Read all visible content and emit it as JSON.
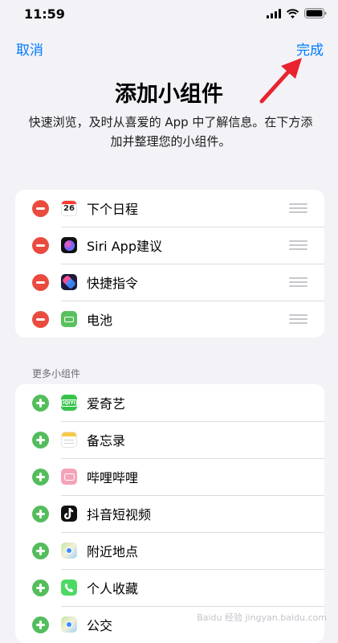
{
  "status": {
    "time": "11:59"
  },
  "nav": {
    "cancel": "取消",
    "done": "完成"
  },
  "title": "添加小组件",
  "subtitle": "快速浏览，及时从喜爱的 App 中了解信息。在下方添加并整理您的小组件。",
  "active_widgets": [
    {
      "label": "下个日程",
      "icon": "calendar-icon",
      "icon_text": "26"
    },
    {
      "label": "Siri App建议",
      "icon": "siri-icon"
    },
    {
      "label": "快捷指令",
      "icon": "shortcuts-icon"
    },
    {
      "label": "电池",
      "icon": "battery-widget-icon"
    }
  ],
  "more_header": "更多小组件",
  "more_widgets": [
    {
      "label": "爱奇艺",
      "icon": "iqiyi-icon",
      "icon_text": "iQIYI"
    },
    {
      "label": "备忘录",
      "icon": "notes-icon"
    },
    {
      "label": "哔哩哔哩",
      "icon": "bilibili-icon"
    },
    {
      "label": "抖音短视频",
      "icon": "douyin-icon"
    },
    {
      "label": "附近地点",
      "icon": "maps-icon"
    },
    {
      "label": "个人收藏",
      "icon": "phone-icon"
    },
    {
      "label": "公交",
      "icon": "transit-maps-icon"
    }
  ],
  "watermark": "Baidu 经验 jingyan.baidu.com",
  "colors": {
    "accent": "#007aff",
    "remove": "#ea4b3f",
    "add": "#53bd5c",
    "annotation_arrow": "#e8232f"
  }
}
